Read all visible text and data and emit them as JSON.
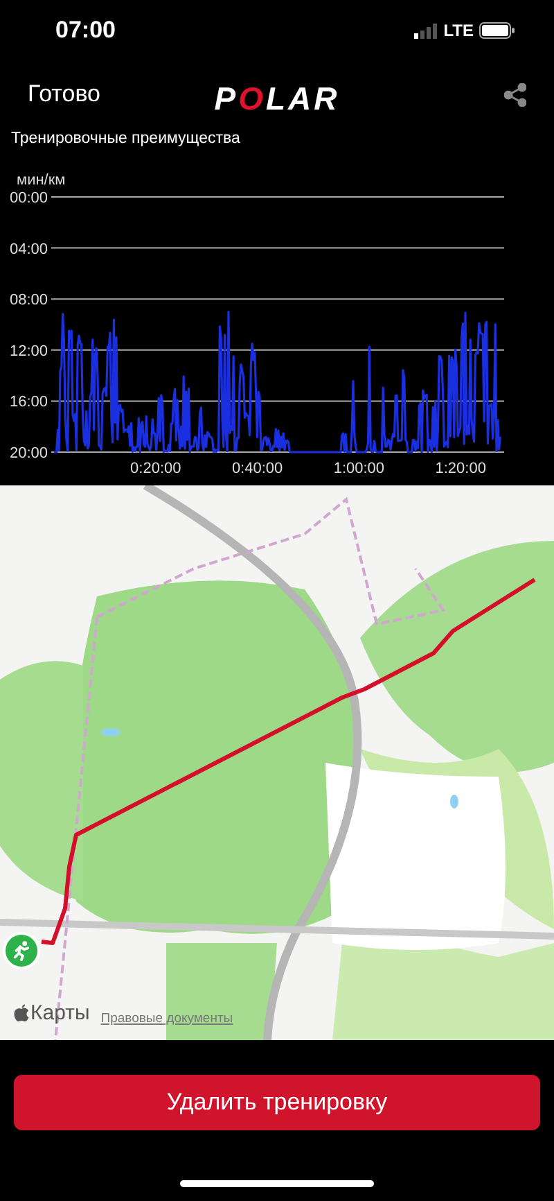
{
  "status_bar": {
    "time": "07:00",
    "network": "LTE"
  },
  "nav": {
    "done": "Готово",
    "logo": "POLAR"
  },
  "title": "Тренировочные преимущества",
  "chart": {
    "y_unit": "мин/км",
    "y_ticks": [
      "00:00",
      "04:00",
      "08:00",
      "12:00",
      "16:00",
      "20:00"
    ],
    "x_ticks": [
      "0:20:00",
      "0:40:00",
      "1:00:00",
      "1:20:00"
    ]
  },
  "map": {
    "kind": "picture",
    "attribution": "Карты",
    "legal_link": "Правовые документы"
  },
  "delete_button": "Удалить тренировку"
}
